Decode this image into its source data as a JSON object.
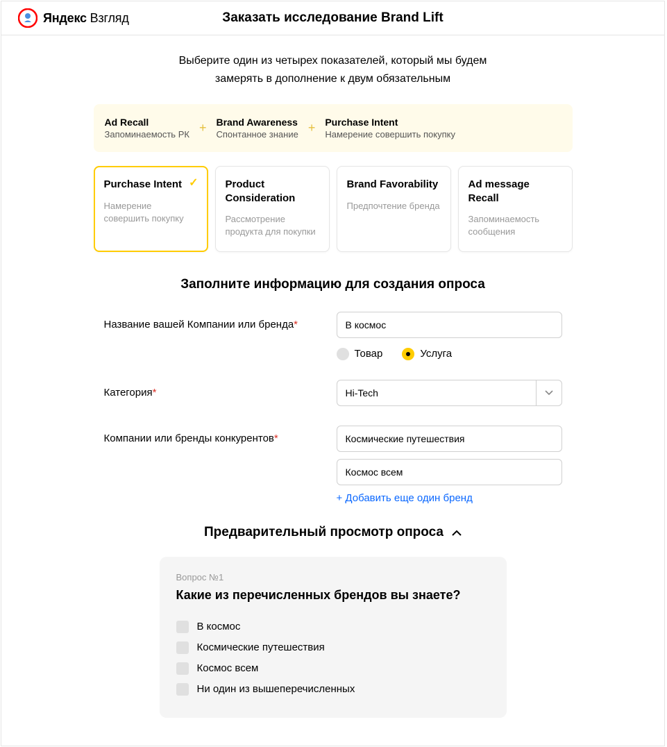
{
  "header": {
    "logo_bold": "Яндекс",
    "logo_light": " Взгляд",
    "title": "Заказать исследование Brand Lift"
  },
  "intro": {
    "line1": "Выберите один из четырех показателей, который мы будем",
    "line2": "замерять в дополнение к двум обязательным"
  },
  "mandatory": [
    {
      "title": "Ad Recall",
      "sub": "Запоминаемость РК"
    },
    {
      "title": "Brand Awareness",
      "sub": "Спонтанное знание"
    },
    {
      "title": "Purchase Intent",
      "sub": "Намерение совершить покупку"
    }
  ],
  "cards": [
    {
      "title": "Purchase Intent",
      "sub": "Намерение совершить покупку",
      "selected": true
    },
    {
      "title": "Product Consideration",
      "sub": "Рассмотрение продукта для покупки",
      "selected": false
    },
    {
      "title": "Brand Favorability",
      "sub": "Предпочтение бренда",
      "selected": false
    },
    {
      "title": "Ad message Recall",
      "sub": "Запоминаемость сообщения",
      "selected": false
    }
  ],
  "form_title": "Заполните информацию для создания опроса",
  "form": {
    "brand_label": "Название вашей Компании или бренда",
    "brand_value": "В космос",
    "radio_product": "Товар",
    "radio_service": "Услуга",
    "category_label": "Категория",
    "category_value": "Hi-Tech",
    "competitors_label": "Компании или бренды конкурентов",
    "competitor1": "Космические путешествия",
    "competitor2": "Космос всем",
    "add_more": "+ Добавить еще один бренд"
  },
  "preview": {
    "title": "Предварительный просмотр опроса",
    "q_label": "Вопрос №1",
    "q_title": "Какие из перечисленных брендов вы знаете?",
    "options": [
      "В космос",
      "Космические путешествия",
      "Космос всем",
      "Ни один из вышеперечисленных"
    ]
  }
}
